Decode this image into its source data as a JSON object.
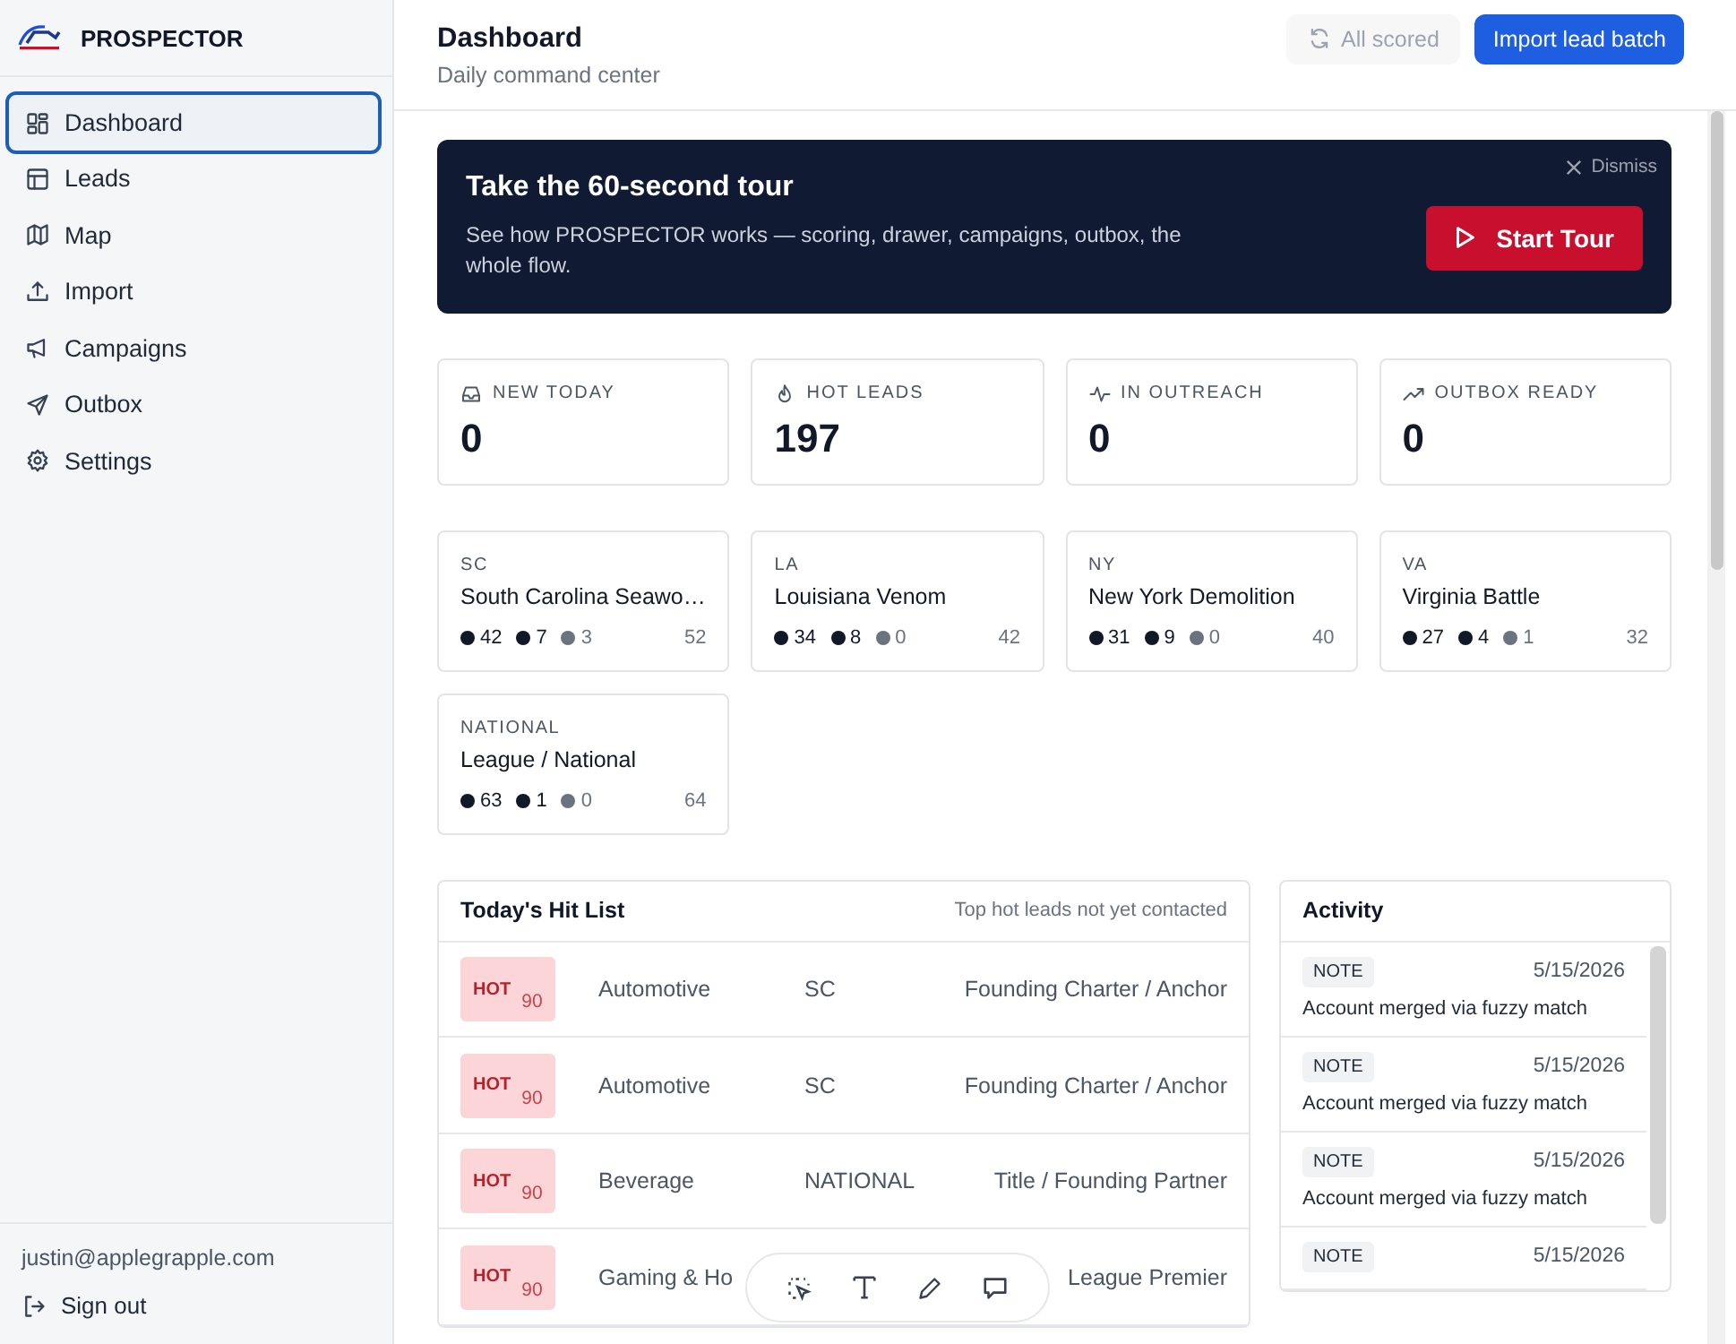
{
  "sidebar": {
    "brand": "PROSPECTOR",
    "items": [
      {
        "label": "Dashboard",
        "selected": true
      },
      {
        "label": "Leads",
        "selected": false
      },
      {
        "label": "Map",
        "selected": false
      },
      {
        "label": "Import",
        "selected": false
      },
      {
        "label": "Campaigns",
        "selected": false
      },
      {
        "label": "Outbox",
        "selected": false
      },
      {
        "label": "Settings",
        "selected": false
      }
    ],
    "email": "justin@applegrapple.com",
    "sign_out": "Sign out"
  },
  "header": {
    "title": "Dashboard",
    "subtitle": "Daily command center",
    "status_button": "All scored",
    "primary_button": "Import lead batch"
  },
  "tour": {
    "title": "Take the 60-second tour",
    "text": "See how PROSPECTOR works — scoring, drawer, campaigns, outbox, the whole flow.",
    "dismiss": "Dismiss",
    "start": "Start Tour"
  },
  "stats": [
    {
      "label": "NEW TODAY",
      "value": "0"
    },
    {
      "label": "HOT LEADS",
      "value": "197"
    },
    {
      "label": "IN OUTREACH",
      "value": "0"
    },
    {
      "label": "OUTBOX READY",
      "value": "0"
    }
  ],
  "teams": [
    {
      "code": "SC",
      "name": "South Carolina Seawo…",
      "counts": [
        {
          "value": "42",
          "color": "#111827"
        },
        {
          "value": "7",
          "color": "#111827"
        },
        {
          "value": "3",
          "color": "#6b7280"
        }
      ],
      "total": "52"
    },
    {
      "code": "LA",
      "name": "Louisiana Venom",
      "counts": [
        {
          "value": "34",
          "color": "#111827"
        },
        {
          "value": "8",
          "color": "#111827"
        },
        {
          "value": "0",
          "color": "#6b7280"
        }
      ],
      "total": "42"
    },
    {
      "code": "NY",
      "name": "New York Demolition",
      "counts": [
        {
          "value": "31",
          "color": "#111827"
        },
        {
          "value": "9",
          "color": "#111827"
        },
        {
          "value": "0",
          "color": "#6b7280"
        }
      ],
      "total": "40"
    },
    {
      "code": "VA",
      "name": "Virginia Battle",
      "counts": [
        {
          "value": "27",
          "color": "#111827"
        },
        {
          "value": "4",
          "color": "#111827"
        },
        {
          "value": "1",
          "color": "#6b7280"
        }
      ],
      "total": "32"
    },
    {
      "code": "NATIONAL",
      "name": "League / National",
      "counts": [
        {
          "value": "63",
          "color": "#111827"
        },
        {
          "value": "1",
          "color": "#111827"
        },
        {
          "value": "0",
          "color": "#6b7280"
        }
      ],
      "total": "64"
    }
  ],
  "hit_list": {
    "title": "Today's Hit List",
    "subtitle": "Top hot leads not yet contacted",
    "rows": [
      {
        "tier": "HOT",
        "score": "90",
        "industry": "Automotive",
        "market": "SC",
        "package": "Founding Charter / Anchor"
      },
      {
        "tier": "HOT",
        "score": "90",
        "industry": "Automotive",
        "market": "SC",
        "package": "Founding Charter / Anchor"
      },
      {
        "tier": "HOT",
        "score": "90",
        "industry": "Beverage",
        "market": "NATIONAL",
        "package": "Title / Founding Partner"
      },
      {
        "tier": "HOT",
        "score": "90",
        "industry": "Gaming & Ho",
        "package": "League Premier"
      }
    ]
  },
  "activity": {
    "title": "Activity",
    "items": [
      {
        "type": "NOTE",
        "date": "5/15/2026",
        "text": "Account merged via fuzzy match"
      },
      {
        "type": "NOTE",
        "date": "5/15/2026",
        "text": "Account merged via fuzzy match"
      },
      {
        "type": "NOTE",
        "date": "5/15/2026",
        "text": "Account merged via fuzzy match"
      },
      {
        "type": "NOTE",
        "date": "5/15/2026"
      }
    ]
  }
}
